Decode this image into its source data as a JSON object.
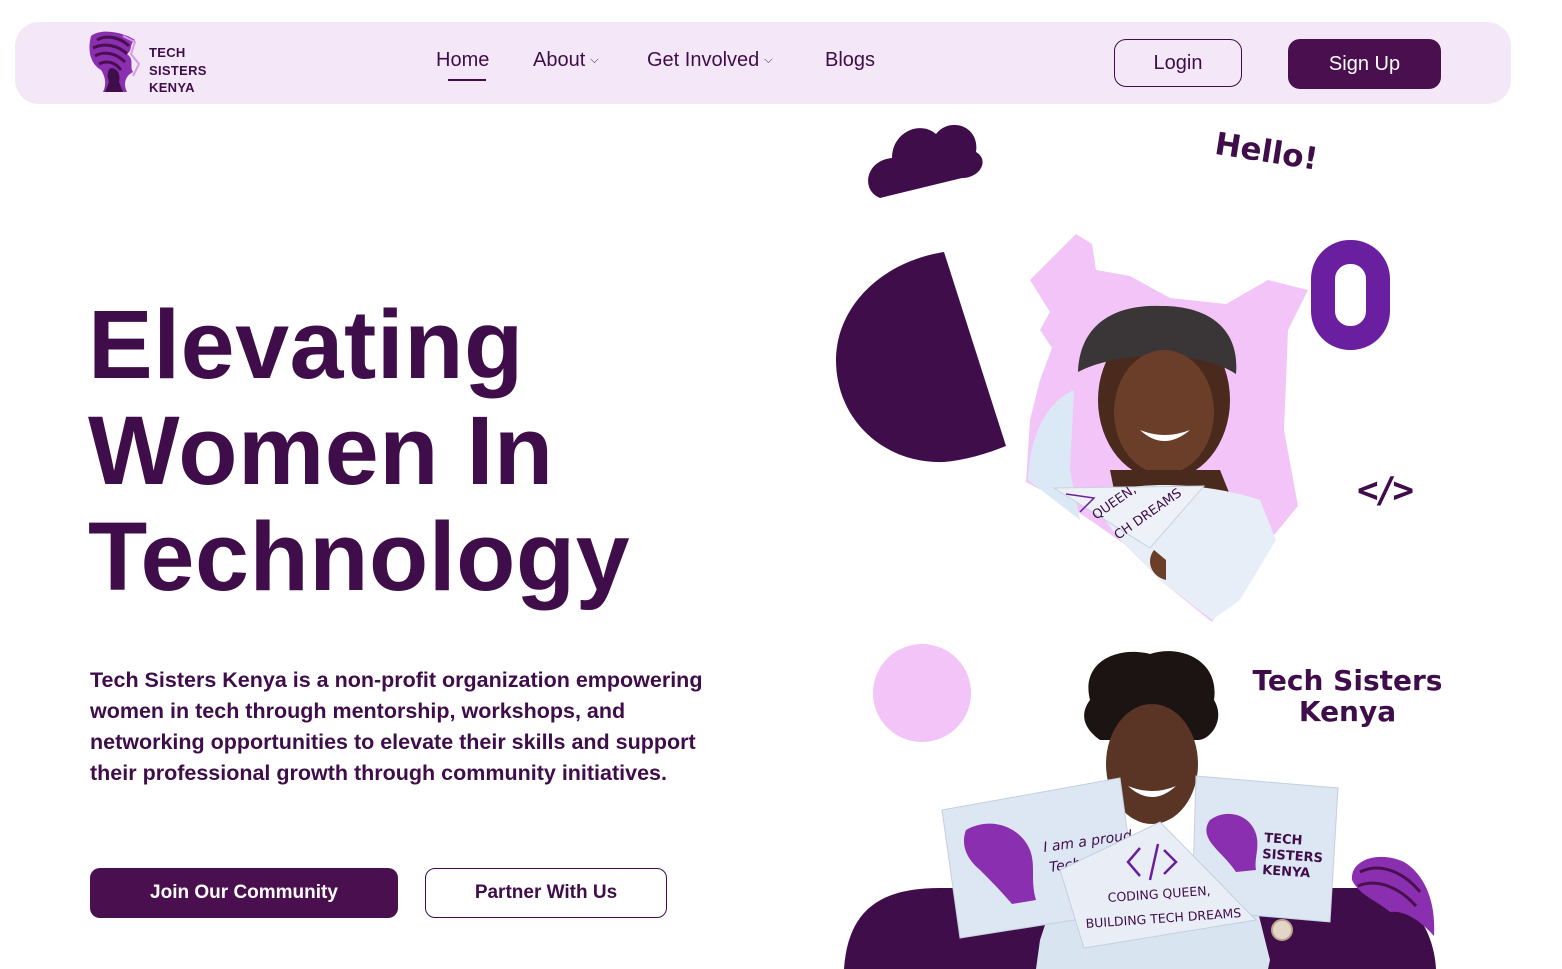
{
  "brand": {
    "name_lines": [
      "TECH",
      "SISTERS",
      "KENYA"
    ],
    "logo_icon": "woman-silhouette-logo-icon"
  },
  "nav": {
    "items": [
      {
        "label": "Home",
        "active": true,
        "has_dropdown": false
      },
      {
        "label": "About",
        "active": false,
        "has_dropdown": true
      },
      {
        "label": "Get Involved",
        "active": false,
        "has_dropdown": true
      },
      {
        "label": "Blogs",
        "active": false,
        "has_dropdown": false
      }
    ],
    "chevron": "⌵",
    "login_label": "Login",
    "signup_label": "Sign Up"
  },
  "hero": {
    "title_lines": [
      "Elevating",
      "Women In",
      "Technology"
    ],
    "description": "Tech Sisters Kenya is a non-profit organization empowering women in tech through mentorship, workshops, and networking opportunities to elevate their skills and support their professional growth through community initiatives.",
    "primary_cta": "Join Our Community",
    "secondary_cta": "Partner With Us"
  },
  "art": {
    "hello": "Hello!",
    "code_symbol": "</>",
    "side_brand_lines": [
      "Tech Sisters",
      "Kenya"
    ],
    "pennant_text_lines": [
      "QUEEN,",
      "CH DREAMS"
    ],
    "sign_left_lines": [
      "I am a proud",
      "Tech Sister"
    ],
    "sign_center_lines": [
      "CODING QUEEN,",
      "BUILDING TECH DREAMS"
    ],
    "sign_right_lines": [
      "TECH",
      "SISTERS",
      "KENYA"
    ]
  },
  "colors": {
    "primary": "#4a0f4f",
    "text": "#3f0d4a",
    "nav_bg": "#f4e8f8",
    "accent_violet": "#6a1fa0",
    "pink": "#f2c4f7"
  }
}
